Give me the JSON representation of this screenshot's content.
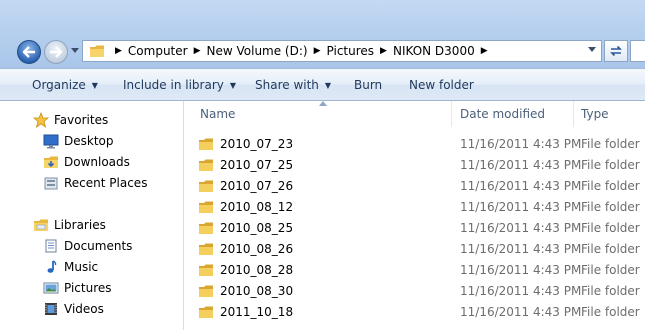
{
  "address": {
    "crumbs": [
      "Computer",
      "New Volume (D:)",
      "Pictures",
      "NIKON D3000"
    ]
  },
  "toolbar": {
    "organize": "Organize",
    "include_in_library": "Include in library",
    "share_with": "Share with",
    "burn": "Burn",
    "new_folder": "New folder"
  },
  "nav": {
    "favorites": "Favorites",
    "desktop": "Desktop",
    "downloads": "Downloads",
    "recent_places": "Recent Places",
    "libraries": "Libraries",
    "documents": "Documents",
    "music": "Music",
    "pictures": "Pictures",
    "videos": "Videos"
  },
  "columns": {
    "name": "Name",
    "date_modified": "Date modified",
    "type": "Type"
  },
  "files": [
    {
      "name": "2010_07_23",
      "date": "11/16/2011 4:43 PM",
      "type": "File folder"
    },
    {
      "name": "2010_07_25",
      "date": "11/16/2011 4:43 PM",
      "type": "File folder"
    },
    {
      "name": "2010_07_26",
      "date": "11/16/2011 4:43 PM",
      "type": "File folder"
    },
    {
      "name": "2010_08_12",
      "date": "11/16/2011 4:43 PM",
      "type": "File folder"
    },
    {
      "name": "2010_08_25",
      "date": "11/16/2011 4:43 PM",
      "type": "File folder"
    },
    {
      "name": "2010_08_26",
      "date": "11/16/2011 4:43 PM",
      "type": "File folder"
    },
    {
      "name": "2010_08_28",
      "date": "11/16/2011 4:43 PM",
      "type": "File folder"
    },
    {
      "name": "2010_08_30",
      "date": "11/16/2011 4:43 PM",
      "type": "File folder"
    },
    {
      "name": "2011_10_18",
      "date": "11/16/2011 4:43 PM",
      "type": "File folder"
    }
  ],
  "colors": {
    "titlebar": "#b7d0ee",
    "folder": "#f3c95a",
    "header_text": "#4c607a",
    "meta_text": "#6d6d6d"
  }
}
